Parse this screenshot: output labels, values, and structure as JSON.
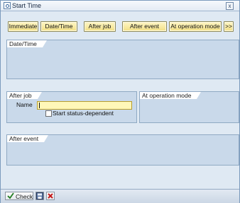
{
  "window": {
    "title": "Start Time",
    "close_glyph": "x"
  },
  "toolbar": {
    "buttons": [
      "Immediate",
      "Date/Time",
      "After job",
      "After event",
      "At operation mode",
      ">>"
    ]
  },
  "groups": {
    "date_time": "Date/Time",
    "after_job": "After job",
    "at_operation_mode": "At operation mode",
    "after_event": "After event"
  },
  "after_job": {
    "name_label": "Name",
    "name_value": "",
    "status_checkbox_label": "Start status-dependent",
    "status_checked": false
  },
  "footer": {
    "check_label": "Check",
    "check_icon": "checkmark-icon",
    "save_icon": "save-icon",
    "cancel_icon": "cancel-icon"
  }
}
